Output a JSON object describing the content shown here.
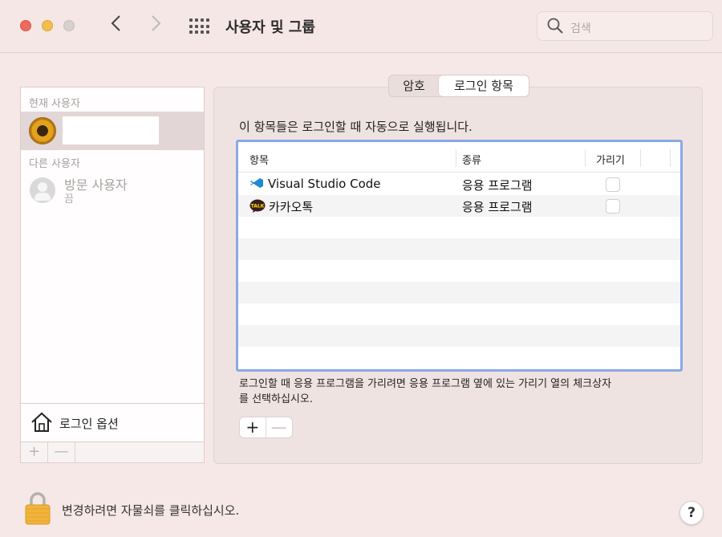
{
  "window": {
    "title": "사용자 및 그룹",
    "search_placeholder": "검색"
  },
  "sidebar": {
    "current_section": "현재 사용자",
    "other_section": "다른 사용자",
    "current_user_name": "",
    "guest": {
      "name": "방문 사용자",
      "status": "끔"
    },
    "login_options_label": "로그인 옵션",
    "add_label": "+",
    "remove_label": "—"
  },
  "tabs": [
    {
      "label": "암호",
      "active": false
    },
    {
      "label": "로그인 항목",
      "active": true
    }
  ],
  "login_items": {
    "description": "이 항목들은 로그인할 때 자동으로 실행됩니다.",
    "columns": [
      "항목",
      "종류",
      "가리기"
    ],
    "rows": [
      {
        "name": "Visual Studio Code",
        "kind": "응용 프로그램",
        "hide": false,
        "icon": "vscode-icon"
      },
      {
        "name": "카카오톡",
        "kind": "응용 프로그램",
        "hide": false,
        "icon": "kakaotalk-icon"
      }
    ],
    "note": "로그인할 때 응용 프로그램을 가리려면 응용 프로그램 옆에 있는 가리기 열의 체크상자를 선택하십시오.",
    "add_label": "+",
    "remove_label": "—"
  },
  "footer": {
    "lock_text": "변경하려면 자물쇠를 클릭하십시오.",
    "help_label": "?"
  },
  "colors": {
    "accent_focus": "#8aa8e6",
    "window_bg": "#f5e8e6"
  }
}
